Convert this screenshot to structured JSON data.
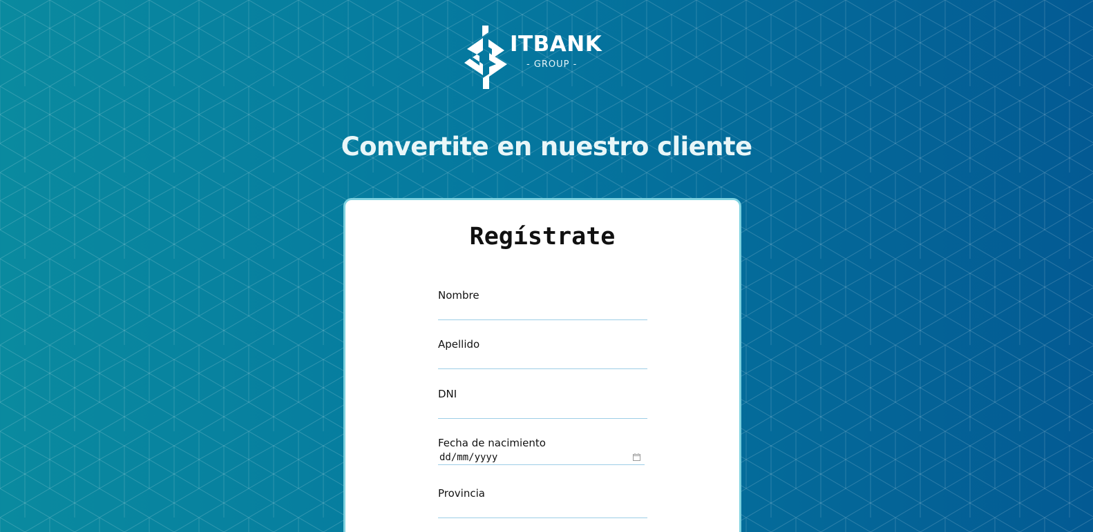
{
  "brand": {
    "name": "ITBANK",
    "tagline": "- GROUP -",
    "icon": "itbank-logo-mark"
  },
  "hero": {
    "title": "Convertite en nuestro cliente"
  },
  "form": {
    "title": "Regístrate",
    "fields": [
      {
        "label": "Nombre",
        "value": ""
      },
      {
        "label": "Apellido",
        "value": ""
      },
      {
        "label": "DNI",
        "value": ""
      },
      {
        "label": "Fecha de nacimiento",
        "value": "dd/mm/yyyy",
        "icon": "calendar-icon"
      },
      {
        "label": "Provincia",
        "value": ""
      }
    ]
  },
  "colors": {
    "background_start": "#0a8a9f",
    "background_end": "#035a93",
    "card_border": "#7fd2e0",
    "input_underline": "#9ccde6",
    "heading_text": "#e8f6f8"
  }
}
